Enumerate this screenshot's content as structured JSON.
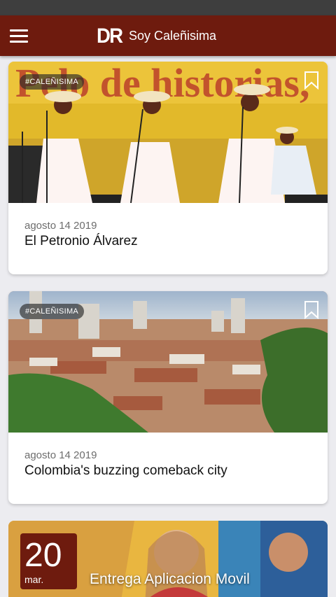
{
  "app": {
    "title": "Soy Caleñisima",
    "logo": "DR",
    "menu_icon": "hamburger-icon"
  },
  "colors": {
    "brand": "#6e1b0e",
    "background": "#ececf0"
  },
  "articles": [
    {
      "tag": "#CALEÑISIMA",
      "date": "agosto 14 2019",
      "title": "El Petronio Álvarez",
      "banner_text": "Pelo de historias,"
    },
    {
      "tag": "#CALEÑISIMA",
      "date": "agosto 14 2019",
      "title": "Colombia's buzzing comeback city"
    }
  ],
  "event": {
    "day": "20",
    "month": "mar.",
    "title": "Entrega Aplicacion Movil"
  }
}
